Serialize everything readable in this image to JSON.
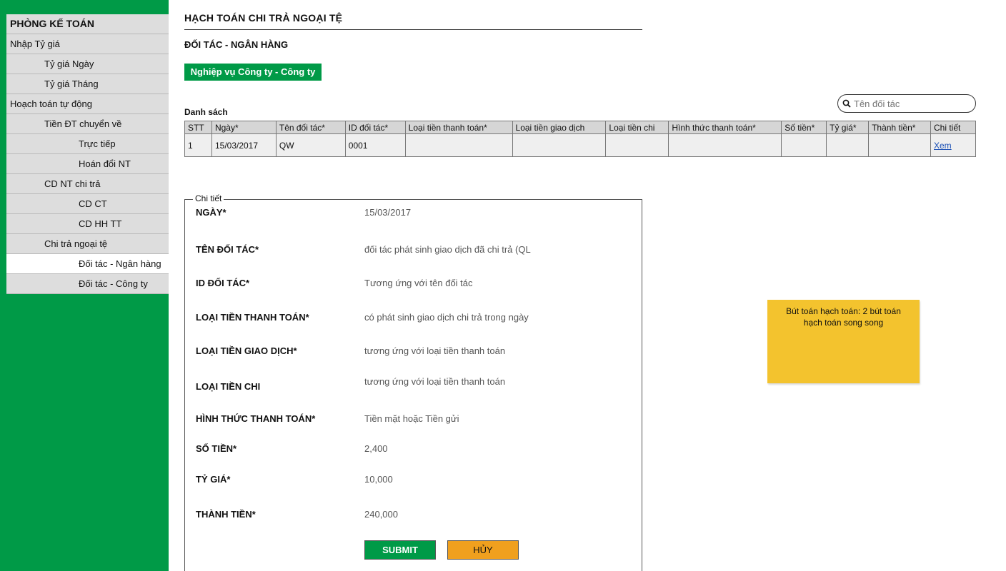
{
  "sidebar": {
    "items": [
      {
        "label": "PHÒNG KẾ TOÁN"
      },
      {
        "label": "Nhập Tỷ giá"
      },
      {
        "label": "Tỷ giá Ngày"
      },
      {
        "label": "Tỷ giá Tháng"
      },
      {
        "label": "Hoạch toán tự động"
      },
      {
        "label": "Tiền ĐT chuyển về"
      },
      {
        "label": "Trực tiếp"
      },
      {
        "label": "Hoán đổi NT"
      },
      {
        "label": "CD NT chi trả"
      },
      {
        "label": "CD CT"
      },
      {
        "label": "CD HH TT"
      },
      {
        "label": "Chi trả ngoại tệ"
      },
      {
        "label": "Đối tác - Ngân hàng"
      },
      {
        "label": "Đối tác - Công ty"
      }
    ],
    "colors": {
      "background": "#009a47",
      "item": "#dddddd",
      "active": "#ffffff"
    }
  },
  "header": {
    "title": "HẠCH TOÁN CHI TRẢ NGOẠI TỆ",
    "subtitle": "ĐỐI TÁC - NGÂN HÀNG",
    "switch_button": "Nghiệp vụ Công ty - Công ty"
  },
  "list": {
    "label": "Danh sách",
    "search_placeholder": "Tên đối tác",
    "columns": [
      "STT",
      "Ngày*",
      "Tên đối tác*",
      "ID đối tác*",
      "Loại tiền thanh toán*",
      "Loại tiền giao dịch",
      "Loại tiền chi",
      "Hình thức thanh toán*",
      "Số tiền*",
      "Tỷ giá*",
      "Thành tiền*",
      "Chi tiết"
    ],
    "rows": [
      [
        "1",
        "15/03/2017",
        "QW",
        "0001",
        "",
        "",
        "",
        "",
        "",
        "",
        "",
        "Xem"
      ]
    ]
  },
  "detail": {
    "legend": "Chi tiết",
    "fields": [
      {
        "label": "NGÀY*",
        "value": "15/03/2017"
      },
      {
        "label": "TÊN ĐỐI TÁC*",
        "value": "đối tác phát sinh giao dịch đã chi trả  (QL"
      },
      {
        "label": "ID ĐỐI TÁC*",
        "value": "Tương ứng với tên đối tác"
      },
      {
        "label": "LOẠI TIỀN THANH TOÁN*",
        "value": "có phát sinh giao dịch chi trả trong ngày"
      },
      {
        "label": "LOẠI TIỀN GIAO DỊCH*",
        "value": "tương ứng với loại tiền thanh toán"
      },
      {
        "label": "LOẠI TIỀN CHI",
        "value": "tương ứng với loại tiền thanh toán"
      },
      {
        "label": "HÌNH THỨC THANH TOÁN*",
        "value": "Tiền mặt hoặc Tiền gửi"
      },
      {
        "label": "SỐ TIỀN*",
        "value": "2,400"
      },
      {
        "label": "TỶ GIÁ*",
        "value": "10,000"
      },
      {
        "label": "THÀNH TIỀN*",
        "value": "240,000"
      }
    ],
    "submit_label": "SUBMIT",
    "cancel_label": "HỦY"
  },
  "note": {
    "text": "Bút toán hạch toán: 2 bút toán hạch toán song song",
    "color": "#f3c32e"
  }
}
